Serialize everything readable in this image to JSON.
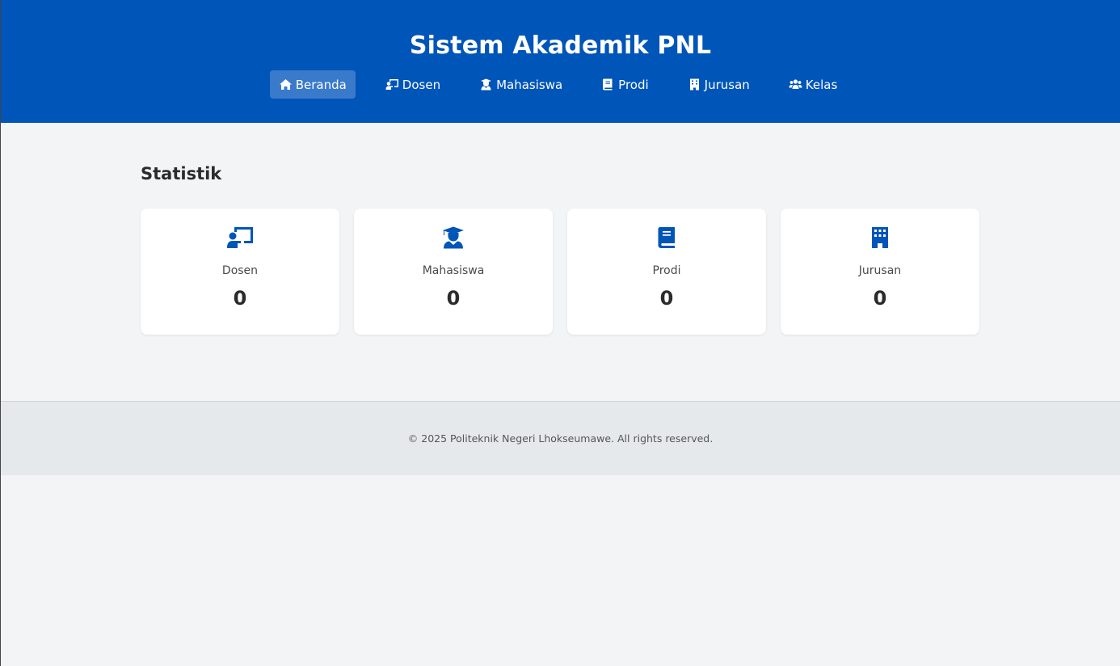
{
  "header": {
    "title": "Sistem Akademik PNL",
    "nav": [
      {
        "label": "Beranda",
        "icon": "home-icon",
        "active": true
      },
      {
        "label": "Dosen",
        "icon": "chalkboard-teacher-icon"
      },
      {
        "label": "Mahasiswa",
        "icon": "graduate-icon"
      },
      {
        "label": "Prodi",
        "icon": "book-icon"
      },
      {
        "label": "Jurusan",
        "icon": "building-icon"
      },
      {
        "label": "Kelas",
        "icon": "users-icon"
      }
    ]
  },
  "main": {
    "title": "Statistik",
    "cards": [
      {
        "label": "Dosen",
        "value": "0",
        "icon": "chalkboard-teacher-icon"
      },
      {
        "label": "Mahasiswa",
        "value": "0",
        "icon": "graduate-icon"
      },
      {
        "label": "Prodi",
        "value": "0",
        "icon": "book-icon"
      },
      {
        "label": "Jurusan",
        "value": "0",
        "icon": "building-icon"
      }
    ]
  },
  "footer": {
    "text": "© 2025 Politeknik Negeri Lhokseumawe. All rights reserved."
  },
  "colors": {
    "primary": "#0055b8",
    "active_nav": "#3a7acb",
    "page_bg": "#f3f4f6",
    "footer_bg": "#e6e9ec"
  }
}
